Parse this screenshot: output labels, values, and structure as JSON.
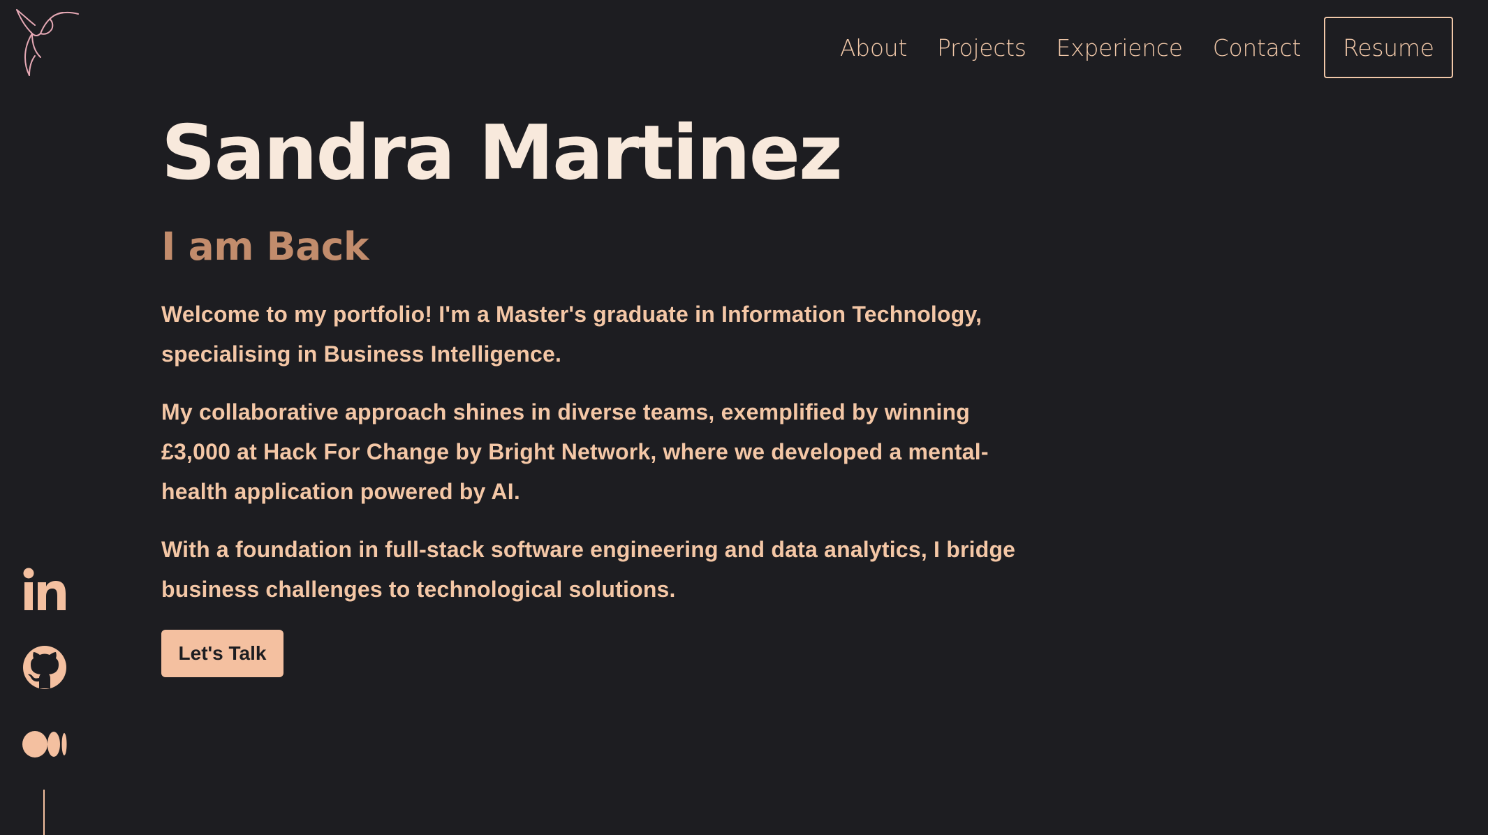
{
  "nav": {
    "links": [
      "About",
      "Projects",
      "Experience",
      "Contact"
    ],
    "resume_label": "Resume"
  },
  "hero": {
    "name": "Sandra Martinez",
    "subtitle": "I am Back",
    "paragraphs": [
      "Welcome to my portfolio! I'm a Master's graduate in Information Technology, specialising in Business Intelligence.",
      "My collaborative approach shines in diverse teams, exemplified by winning £3,000 at Hack For Change by Bright Network, where we developed a mental-health application powered by AI.",
      "With a foundation in full-stack software engineering and data analytics, I bridge business challenges to technological solutions."
    ],
    "cta_label": "Let's Talk"
  },
  "social": {
    "icons": [
      "linkedin-icon",
      "github-icon",
      "medium-icon"
    ]
  },
  "colors": {
    "background": "#1d1d21",
    "accent": "#f4c0a0",
    "name": "#f8e9dc",
    "subtitle": "#c28c6c"
  }
}
